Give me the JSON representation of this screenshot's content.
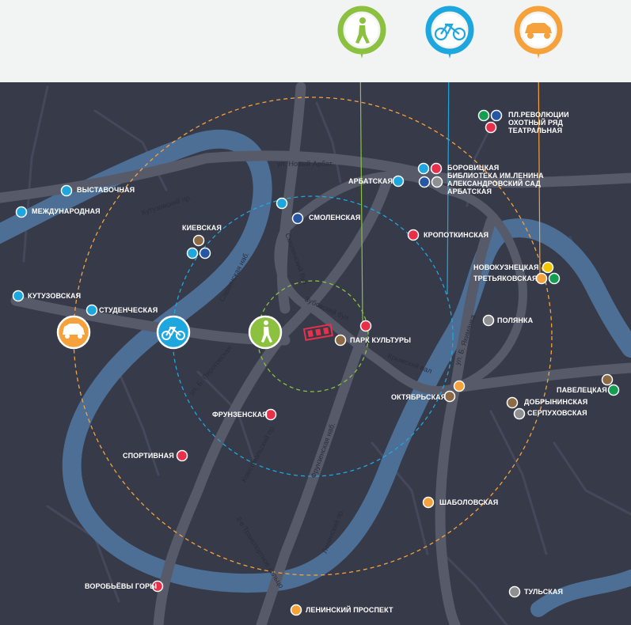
{
  "colors": {
    "background_top": "#f2f3f3",
    "map_base": "#373a49",
    "road": "#565a69",
    "river": "#4d6f95",
    "walk": "#8bc13f",
    "bike": "#1ea7df",
    "car": "#f5a23c",
    "venue": "#e8304b"
  },
  "modes": [
    {
      "id": "walk",
      "icon": "walker-icon",
      "color": "#8bc13f"
    },
    {
      "id": "bike",
      "icon": "bicycle-icon",
      "color": "#1ea7df"
    },
    {
      "id": "car",
      "icon": "car-icon",
      "color": "#f5a23c"
    }
  ],
  "streets": {
    "novy_arbat": "ул. Новый Арбат",
    "kutuzovsky": "Кутузовский пр.",
    "savvinskaya": "Саввинская наб.",
    "smolensky": "Смоленский бул.",
    "zubovsky": "Зубовский бул.",
    "pirogovskaya": "ул. Б. Пироговская",
    "komsomolsky": "Комсомольский пр.",
    "frunzenskaya": "Фрунзенская наб.",
    "krymsky": "Крымский вал",
    "yakimanka": "ул. Б. Якиманка",
    "leninsky": "Ленинский пр.",
    "third_ring": "3-е Транспортное кольцо"
  },
  "stations": [
    {
      "name": "ВЫСТАВОЧНАЯ",
      "dots": [
        "#1ea7df"
      ]
    },
    {
      "name": "МЕЖДУНАРОДНАЯ",
      "dots": [
        "#1ea7df"
      ]
    },
    {
      "name": "КИЕВСКАЯ",
      "dots": [
        "#8b6a45",
        "#1ea7df",
        "#2756a4"
      ]
    },
    {
      "name": "СМОЛЕНСКАЯ",
      "dots": [
        "#1ea7df",
        "#2756a4"
      ]
    },
    {
      "name": "АРБАТСКАЯ",
      "dots": [
        "#1ea7df"
      ]
    },
    {
      "name": "БОРОВИЦКАЯ",
      "dots": [
        "#1ea7df",
        "#e8304b"
      ]
    },
    {
      "name": "БИБЛИОТЕКА ИМ.ЛЕНИНА",
      "dots": [
        "#2756a4",
        "#8d8f91"
      ]
    },
    {
      "name": "АЛЕКСАНДРОВСКИЙ САД",
      "dots": []
    },
    {
      "name": "АРБАТСКАЯ",
      "dots": []
    },
    {
      "name": "ПЛ.РЕВОЛЮЦИИ",
      "dots": [
        "#149e4f",
        "#2756a4"
      ]
    },
    {
      "name": "ОХОТНЫЙ РЯД",
      "dots": [
        "#e8304b"
      ]
    },
    {
      "name": "ТЕАТРАЛЬНАЯ",
      "dots": []
    },
    {
      "name": "КРОПОТКИНСКАЯ",
      "dots": [
        "#e8304b"
      ]
    },
    {
      "name": "НОВОКУЗНЕЦКАЯ",
      "dots": [
        "#f2c700"
      ]
    },
    {
      "name": "ТРЕТЬЯКОВСКАЯ",
      "dots": [
        "#f5a23c",
        "#149e4f"
      ]
    },
    {
      "name": "КУТУЗОВСКАЯ",
      "dots": [
        "#1ea7df"
      ]
    },
    {
      "name": "СТУДЕНЧЕСКАЯ",
      "dots": [
        "#1ea7df"
      ]
    },
    {
      "name": "ПАРК КУЛЬТУРЫ",
      "dots": [
        "#e8304b",
        "#8b6a45"
      ]
    },
    {
      "name": "ПОЛЯНКА",
      "dots": [
        "#8d8f91"
      ]
    },
    {
      "name": "ОКТЯБРЬСКАЯ",
      "dots": [
        "#f5a23c",
        "#8b6a45"
      ]
    },
    {
      "name": "ПАВЕЛЕЦКАЯ",
      "dots": [
        "#8b6a45",
        "#149e4f"
      ]
    },
    {
      "name": "ДОБРЫНИНСКАЯ",
      "dots": [
        "#8b6a45"
      ]
    },
    {
      "name": "СЕРПУХОВСКАЯ",
      "dots": [
        "#8d8f91"
      ]
    },
    {
      "name": "ФРУНЗЕНСКАЯ",
      "dots": [
        "#e8304b"
      ]
    },
    {
      "name": "СПОРТИВНАЯ",
      "dots": [
        "#e8304b"
      ]
    },
    {
      "name": "ШАБОЛОВСКАЯ",
      "dots": [
        "#f5a23c"
      ]
    },
    {
      "name": "ВОРОБЬЁВЫ ГОРЫ",
      "dots": [
        "#e8304b"
      ]
    },
    {
      "name": "ЛЕНИНСКИЙ ПРОСПЕКТ",
      "dots": [
        "#f5a23c"
      ]
    },
    {
      "name": "ТУЛЬСКАЯ",
      "dots": [
        "#8d8f91"
      ]
    }
  ]
}
